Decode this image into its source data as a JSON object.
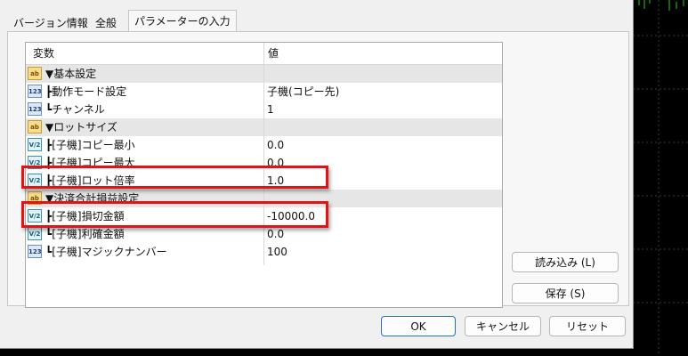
{
  "tabs": [
    "バージョン情報",
    "全般",
    "パラメーターの入力"
  ],
  "grid": {
    "headers": {
      "name": "変数",
      "value": "値"
    },
    "rows": [
      {
        "icon": "ab",
        "name": "▼基本設定",
        "value": ""
      },
      {
        "icon": "123",
        "name": "┣動作モード設定",
        "value": "子機(コピー先)"
      },
      {
        "icon": "123",
        "name": "┗チャンネル",
        "value": "1"
      },
      {
        "icon": "ab",
        "name": "▼ロットサイズ",
        "value": ""
      },
      {
        "icon": "V/2",
        "name": "┣[子機]コピー最小",
        "value": "0.0"
      },
      {
        "icon": "V/2",
        "name": "┣[子機]コピー最大",
        "value": "0.0"
      },
      {
        "icon": "V/2",
        "name": "┣[子機]ロット倍率",
        "value": "1.0"
      },
      {
        "icon": "ab",
        "name": "▼決済合計損益設定",
        "value": ""
      },
      {
        "icon": "V/2",
        "name": "┣[子機]損切金額",
        "value": "-10000.0"
      },
      {
        "icon": "V/2",
        "name": "┗[子機]利確金額",
        "value": "0.0"
      },
      {
        "icon": "123",
        "name": "┗[子機]マジックナンバー",
        "value": "100"
      }
    ]
  },
  "side_buttons": {
    "load": "読み込み (L)",
    "save": "保存 (S)"
  },
  "footer_buttons": {
    "ok": "OK",
    "cancel": "キャンセル",
    "reset": "リセット"
  },
  "icons": [
    "ab-string-icon",
    "integer-123-icon",
    "double-value-icon"
  ],
  "colors": {
    "highlight": "#e01414",
    "section_row": "#e6e6e6",
    "primary_border": "#1e6fd6"
  }
}
